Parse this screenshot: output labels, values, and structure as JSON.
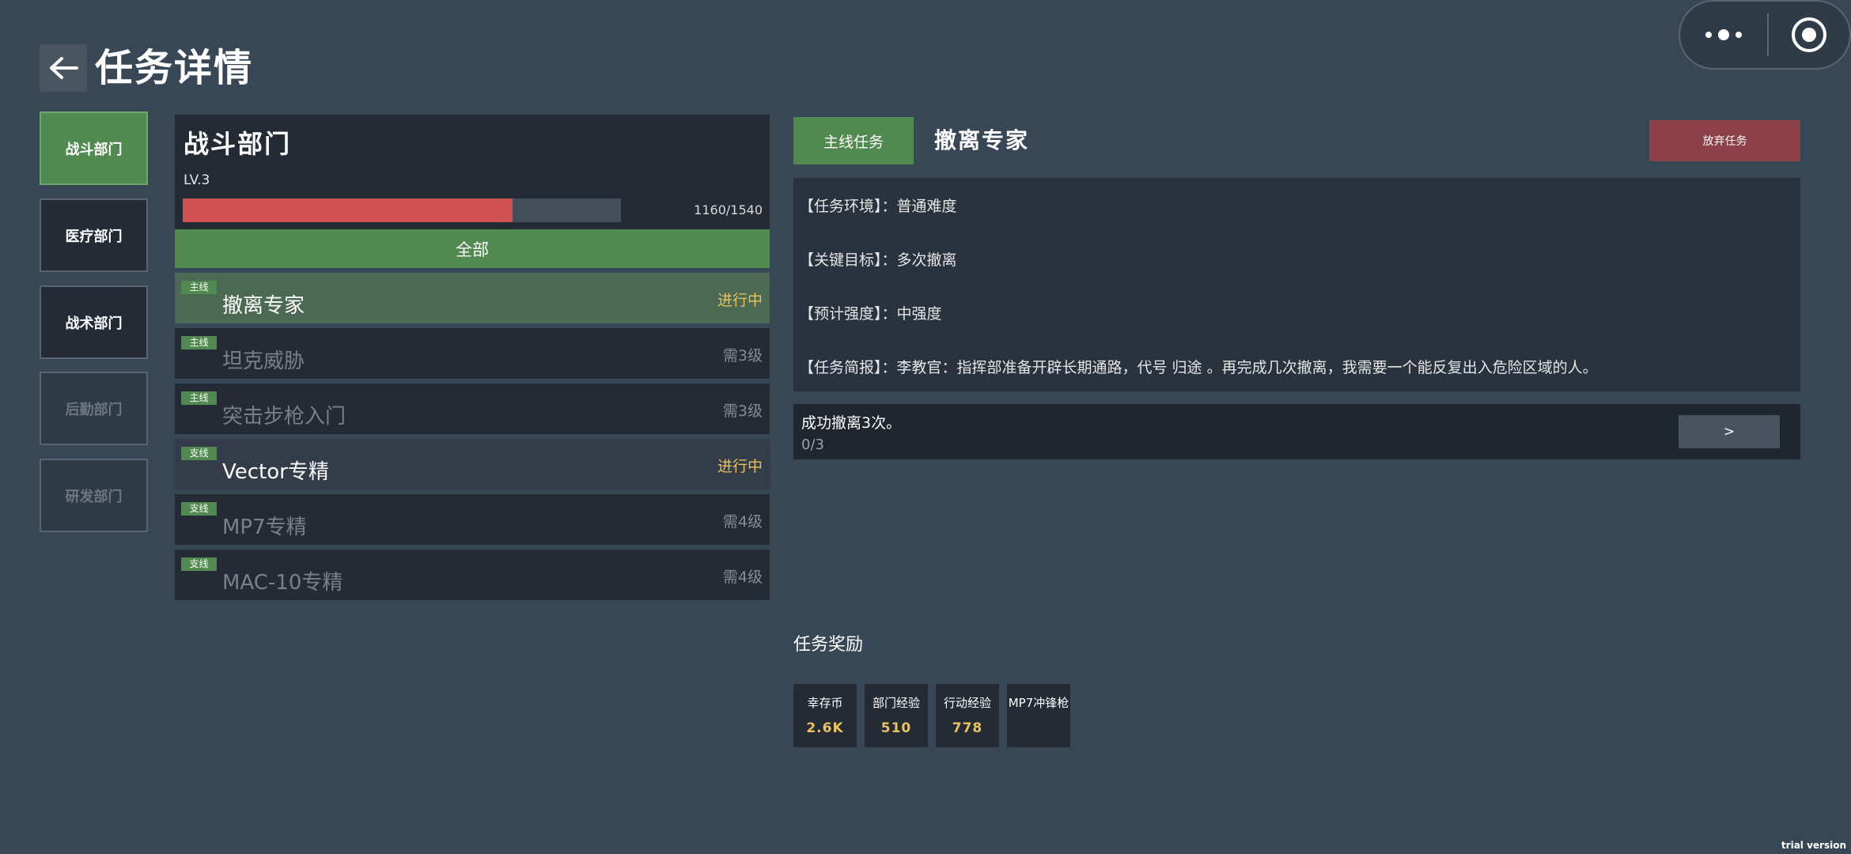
{
  "header": {
    "title": "任务详情",
    "back_icon": "arrow-left-icon"
  },
  "capsule": {
    "more_icon": "more-dots-icon",
    "close_icon": "target-close-icon"
  },
  "departments": [
    {
      "label": "战斗部门",
      "state": "active"
    },
    {
      "label": "医疗部门",
      "state": "normal"
    },
    {
      "label": "战术部门",
      "state": "normal"
    },
    {
      "label": "后勤部门",
      "state": "locked"
    },
    {
      "label": "研发部门",
      "state": "locked"
    }
  ],
  "dept_panel": {
    "name": "战斗部门",
    "level": "LV.3",
    "exp_text": "1160/1540",
    "exp_current": 1160,
    "exp_max": 1540,
    "filter_label": "全部"
  },
  "quests": [
    {
      "tag": "主线",
      "name": "撤离专家",
      "status": "进行中"
    },
    {
      "tag": "主线",
      "name": "坦克威胁",
      "status": "需3级"
    },
    {
      "tag": "主线",
      "name": "突击步枪入门",
      "status": "需3级"
    },
    {
      "tag": "支线",
      "name": "Vector专精",
      "status": "进行中"
    },
    {
      "tag": "支线",
      "name": "MP7专精",
      "status": "需4级"
    },
    {
      "tag": "支线",
      "name": "MAC-10专精",
      "status": "需4级"
    }
  ],
  "detail": {
    "type_label": "主线任务",
    "title": "撤离专家",
    "abandon_label": "放弃任务",
    "lines": [
      "【任务环境】：普通难度",
      "【关键目标】：多次撤离",
      "【预计强度】：中强度",
      "【任务简报】：李教官：指挥部准备开辟长期通路，代号 归途 。再完成几次撤离，我需要一个能反复出入危险区域的人。"
    ],
    "goal_text": "成功撤离3次。",
    "goal_progress": "0/3",
    "goal_button": ">"
  },
  "rewards": {
    "title": "任务奖励",
    "items": [
      {
        "name": "幸存币",
        "value": "2.6K"
      },
      {
        "name": "部门经验",
        "value": "510"
      },
      {
        "name": "行动经验",
        "value": "778"
      },
      {
        "name": "MP7冲锋枪",
        "value": ""
      }
    ]
  },
  "watermark": "trial version",
  "colors": {
    "background": "#374755",
    "accent_green": "#518a50",
    "danger_red": "#8c4148",
    "progress_red": "#cf5154",
    "status_yellow": "#e8c35b"
  }
}
